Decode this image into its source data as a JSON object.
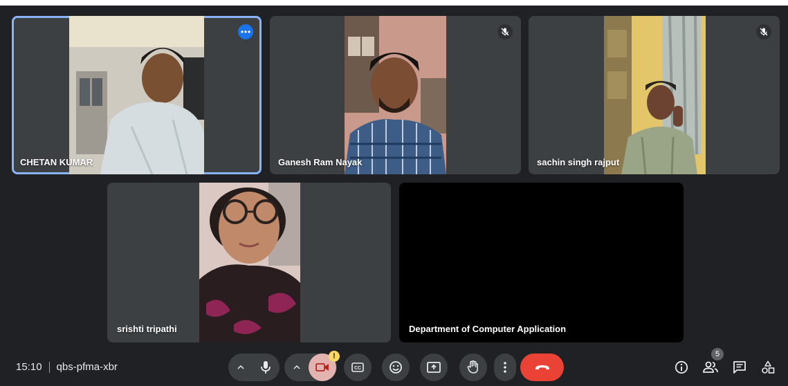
{
  "participants": [
    {
      "name": "CHETAN KUMAR",
      "active": true,
      "status_icon": "more-options-icon"
    },
    {
      "name": "Ganesh Ram Nayak",
      "active": false,
      "status_icon": "mic-off-icon"
    },
    {
      "name": "sachin singh rajput",
      "active": false,
      "status_icon": "mic-off-icon"
    },
    {
      "name": "srishti tripathi",
      "active": false
    },
    {
      "name": "Department of Computer Application",
      "active": false,
      "video_off": true
    }
  ],
  "meeting": {
    "time": "15:10",
    "code": "qbs-pfma-xbr"
  },
  "controls": {
    "camera_warning": "!",
    "people_count": "5",
    "icons": [
      "caret-up-icon",
      "microphone-icon",
      "caret-up-icon",
      "camera-off-icon",
      "captions-icon",
      "emoji-icon",
      "present-icon",
      "raise-hand-icon",
      "more-vert-icon",
      "end-call-icon",
      "info-icon",
      "people-icon",
      "chat-icon",
      "activities-icon"
    ]
  },
  "colors": {
    "background": "#202124",
    "tile": "#3c4043",
    "active_outline": "#8ab4f8",
    "end_call": "#ea4335",
    "camera_off_bg": "#f28b82",
    "accent": "#1a73e8",
    "warning": "#fdd663"
  }
}
